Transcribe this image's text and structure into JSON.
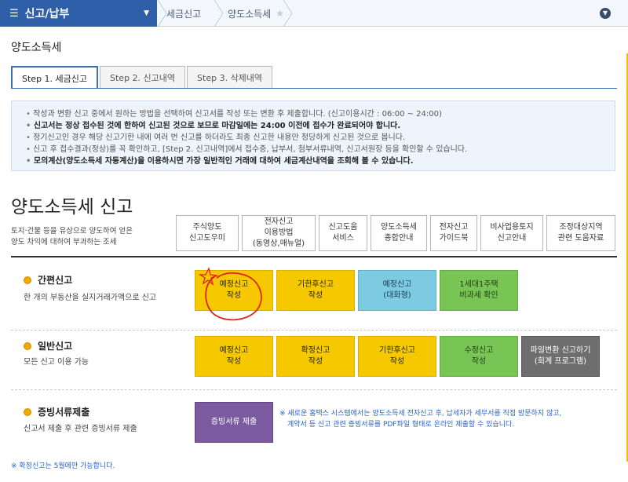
{
  "nav": {
    "main_label": "신고/납부",
    "crumb1": "세금신고",
    "crumb2": "양도소득세"
  },
  "page_title": "양도소득세",
  "tabs": [
    {
      "label": "Step 1. 세금신고",
      "active": true
    },
    {
      "label": "Step 2. 신고내역",
      "active": false
    },
    {
      "label": "Step 3. 삭제내역",
      "active": false
    }
  ],
  "notice": [
    {
      "text": "작성과 변환 신고 중에서 원하는 방법을 선택하여 신고서를 작성 또는 변환 후 제출합니다. (신고이용시간 : 06:00 ~ 24:00)",
      "bold": false
    },
    {
      "text": "신고서는 정상 접수된 것에 한하여 신고된 것으로 보므로 마감일에는 24:00 이전에 접수가 완료되어야 합니다.",
      "bold": true
    },
    {
      "text": "정기신고인 경우 해당 신고기한 내에 여러 번 신고를 하더라도 최종 신고한 내용만 정당하게 신고된 것으로 봅니다.",
      "bold": false
    },
    {
      "text": "신고 후 접수결과(정상)를 꼭 확인하고, [Step 2. 신고내역]에서 접수증, 납부서, 첨부서류내역, 신고서원장 등을 확인할 수 있습니다.",
      "bold": false
    },
    {
      "text": "모의계산(양도소득세 자동계산)을 이용하시면 가장 일반적인 거래에 대하여 세금계산내역을 조회해 볼 수 있습니다.",
      "bold": true
    }
  ],
  "section_title": "양도소득세 신고",
  "description": [
    "토지·건물 등을 유상으로 양도하여 얻은",
    "양도 차익에 대하여 부과하는 조세"
  ],
  "help_buttons": [
    {
      "line1": "주식양도",
      "line2": "신고도우미",
      "line3": ""
    },
    {
      "line1": "전자신고",
      "line2": "이용방법",
      "line3": "(동영상,매뉴얼)"
    },
    {
      "line1": "신고도움",
      "line2": "서비스",
      "line3": ""
    },
    {
      "line1": "양도소득세",
      "line2": "종합안내",
      "line3": ""
    },
    {
      "line1": "전자신고",
      "line2": "가이드북",
      "line3": ""
    },
    {
      "line1": "비사업용토지",
      "line2": "신고안내",
      "line3": ""
    },
    {
      "line1": "조정대상지역",
      "line2": "관련 도움자료",
      "line3": ""
    }
  ],
  "simple": {
    "title": "간편신고",
    "subtitle": "한 개의 부동산을 실지거래가액으로 신고",
    "buttons": [
      {
        "line1": "예정신고",
        "line2": "작성"
      },
      {
        "line1": "기한후신고",
        "line2": "작성"
      },
      {
        "line1": "예정신고",
        "line2": "(대화형)"
      },
      {
        "line1": "1세대1주택",
        "line2": "비과세 확인"
      }
    ]
  },
  "general": {
    "title": "일반신고",
    "subtitle": "모든 신고 이용 가능",
    "buttons": [
      {
        "line1": "예정신고",
        "line2": "작성"
      },
      {
        "line1": "확정신고",
        "line2": "작성"
      },
      {
        "line1": "기한후신고",
        "line2": "작성"
      },
      {
        "line1": "수정신고",
        "line2": "작성"
      },
      {
        "line1": "파일변환 신고하기",
        "line2": "(회계 프로그램)"
      }
    ]
  },
  "evidence": {
    "title": "증빙서류제출",
    "subtitle": "신고서 제출 후 관련 증빙서류 제출",
    "button": "증빙서류 제출",
    "note1": "※ 새로운 홈택스 시스템에서는 양도소득세 전자신고 후, 납세자가 세무서를 직접 방문하지 않고,",
    "note2": "계약서 등 신고 관련 증빙서류를 PDF파일 형태로 온라인 제출할 수 있습니다."
  },
  "footnote": "※ 확정신고는 5월에만 가능합니다.",
  "colors": {
    "nav": "#2f5fa8",
    "yellow": "#f6c800",
    "blue": "#7dcbe0",
    "green": "#78c454",
    "gray": "#6e6e6e",
    "purple": "#7c5aa0",
    "annotation": "#e0201a"
  }
}
